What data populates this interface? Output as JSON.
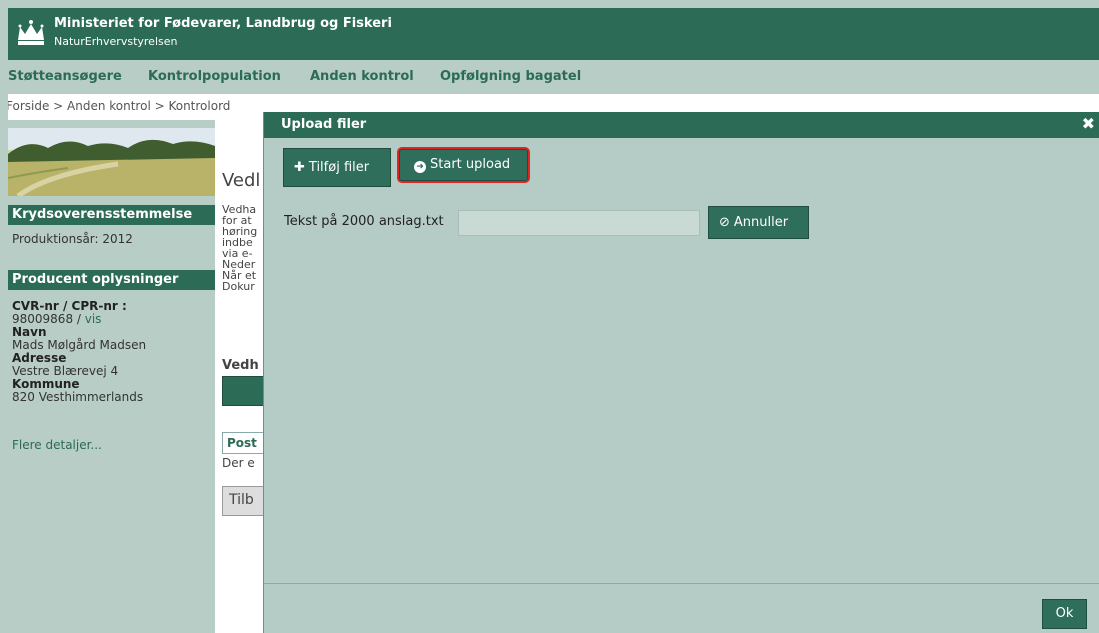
{
  "header": {
    "ministry": "Ministeriet for Fødevarer, Landbrug og Fiskeri",
    "agency": "NaturErhvervstyrelsen",
    "logo_icon": "crown-icon"
  },
  "nav": {
    "items": [
      "Støtteansøgere",
      "Kontrolpopulation",
      "Anden kontrol",
      "Opfølgning bagatel"
    ]
  },
  "breadcrumb": "Forside > Anden kontrol > Kontrolord",
  "sidebar": {
    "section1_title": "Krydsoverensstemmelse",
    "production_year": "Produktionsår: 2012",
    "section2_title": "Producent oplysninger",
    "cvr_label": "CVR-nr / CPR-nr :",
    "cvr_value": "98009868",
    "cvr_sep": " / ",
    "cvr_link": "vis",
    "name_label": "Navn",
    "name_value": "Mads Mølgård Madsen",
    "address_label": "Adresse",
    "address_value": "Vestre Blærevej 4",
    "kommune_label": "Kommune",
    "kommune_value": "820 Vesthimmerlands",
    "more_link": "Flere detaljer..."
  },
  "main": {
    "title": "Vedl",
    "paragraph": [
      "Vedha",
      "for at",
      "høring",
      "indbe",
      "via e-",
      "Neder",
      "Når et",
      "Dokur"
    ],
    "subtitle": "Vedh",
    "box_label": "Post",
    "de_text": "Der e",
    "back_button": "Tilb"
  },
  "dialog": {
    "title": "Upload filer",
    "close_icon": "close-icon",
    "add_files_label": "Tilføj filer",
    "start_upload_label": "Start upload",
    "file_name": "Tekst på 2000 anslag.txt",
    "progress": 0,
    "cancel_label": "Annuller",
    "ok_label": "Ok"
  },
  "colors": {
    "brand_green": "#2c6b56",
    "panel_bg": "#b5ccc6",
    "highlight_red": "#e02424"
  }
}
